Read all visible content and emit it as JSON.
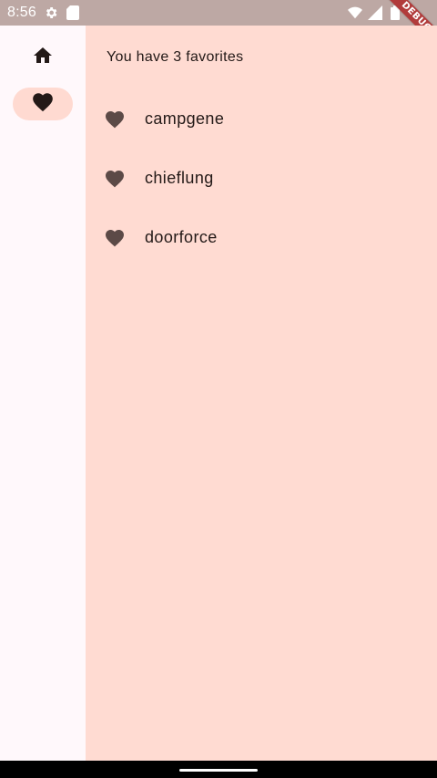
{
  "status_bar": {
    "time": "8:56",
    "left_icons": [
      "gear-icon",
      "sd-card-icon"
    ],
    "right_icons": [
      "wifi-icon",
      "signal-icon",
      "battery-icon"
    ]
  },
  "debug_banner": {
    "label": "DEBUG"
  },
  "nav_rail": {
    "items": [
      {
        "icon": "home-icon",
        "selected": false
      },
      {
        "icon": "heart-icon",
        "selected": true
      }
    ]
  },
  "favorites_page": {
    "summary": "You have 3 favorites",
    "items": [
      {
        "icon": "heart-icon",
        "label": "campgene"
      },
      {
        "icon": "heart-icon",
        "label": "chieflung"
      },
      {
        "icon": "heart-icon",
        "label": "doorforce"
      }
    ]
  },
  "colors": {
    "status_bar_bg": "#bda8a4",
    "rail_bg": "#fff8fb",
    "content_bg": "#ffdbd2",
    "selected_indicator": "#ffdad1",
    "icon_dark": "#231917",
    "list_icon": "#5c4a47",
    "debug_ribbon": "#b13b3b"
  }
}
